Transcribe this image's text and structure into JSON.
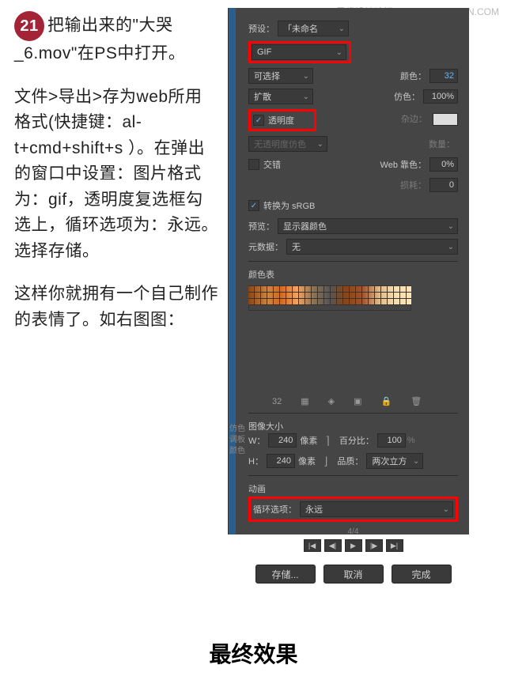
{
  "watermark": "思缘设计论坛   WWW.MISSYUAN.COM",
  "step_number": "21",
  "paragraphs": {
    "p1": "把输出来的\"大哭_6.mov\"在PS中打开。",
    "p2": "文件>导出>存为web所用格式(快捷键：al-t+cmd+shift+s ）。在弹出的窗口中设置：图片格式为：gif，透明度复选框勾选上，循环选项为：永远。选择存储。",
    "p3": "这样你就拥有一个自己制作的表情了。如右图图："
  },
  "panel": {
    "preset_label": "预设：",
    "preset_value": "「未命名",
    "format": "GIF",
    "selectable_label": "可选择",
    "color_label": "颜色：",
    "color_value": "32",
    "diffuse_label": "扩散",
    "dither_label": "仿色：",
    "dither_value": "100%",
    "transparency_label": "透明度",
    "matte_label": "杂边：",
    "no_trans_dither": "无透明度仿色",
    "amount_label": "数量：",
    "interlace_label": "交错",
    "web_snap_label": "Web 靠色：",
    "web_snap_value": "0%",
    "lossy_label": "损耗：",
    "lossy_value": "0",
    "convert_srgb": "转换为 sRGB",
    "preview_label": "预览：",
    "preview_value": "显示器颜色",
    "metadata_label": "元数据：",
    "metadata_value": "无",
    "color_table_label": "颜色表",
    "swatch_count": "32",
    "image_size_label": "图像大小",
    "width_label": "W：",
    "width_value": "240",
    "height_label": "H：",
    "height_value": "240",
    "pixels": "像素",
    "percent_label": "百分比：",
    "percent_value": "100",
    "quality_label": "品质：",
    "quality_value": "两次立方",
    "animation_label": "动画",
    "loop_label": "循环选项：",
    "loop_value": "永远",
    "frame_counter": "4/4",
    "side_labels": {
      "dither": "仿色",
      "adjust": "调板",
      "color": "颜色"
    },
    "buttons": {
      "save": "存储...",
      "cancel": "取消",
      "done": "完成"
    }
  },
  "bottom_title": "最终效果"
}
